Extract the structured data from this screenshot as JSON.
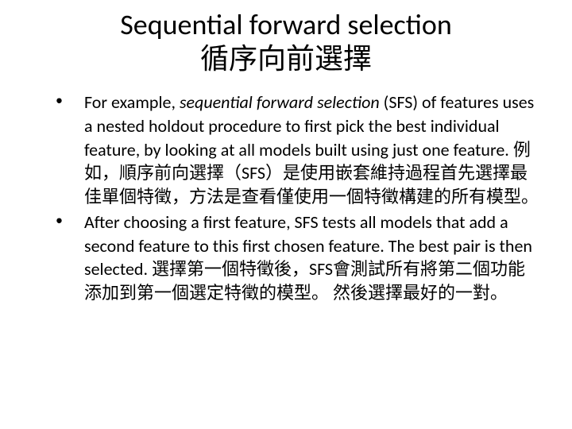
{
  "title": {
    "line1": "Sequential forward selection",
    "line2": "循序向前選擇"
  },
  "bullets": [
    {
      "marker": "•",
      "prefix": "For example, ",
      "emphasis": "sequential forward selection",
      "rest": " (SFS) of features uses a nested holdout procedure to first pick the best individual feature, by looking at all models built using just one feature.  例如，順序前向選擇（SFS）是使用嵌套維持過程首先選擇最佳單個特徵，方法是查看僅使用一個特徵構建的所有模型。"
    },
    {
      "marker": "•",
      "text": "After choosing a first feature, SFS tests all models that add a second feature to this first chosen feature. The best pair is then selected.  選擇第一個特徵後，SFS會測試所有將第二個功能添加到第一個選定特徵的模型。 然後選擇最好的一對。"
    }
  ]
}
